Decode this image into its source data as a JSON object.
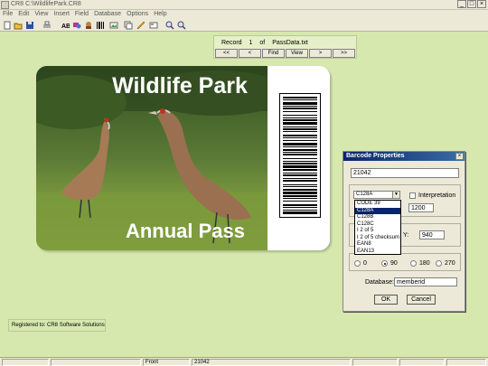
{
  "window": {
    "title": "CR8 C:\\WildlifePark.CR8"
  },
  "menu": [
    "File",
    "Edit",
    "View",
    "Insert",
    "Field",
    "Database",
    "Options",
    "Help"
  ],
  "record": {
    "label": "Record",
    "current": "1",
    "of": "of",
    "file": "PassData.txt"
  },
  "nav": [
    "<<",
    "<",
    "Find",
    "View",
    ">",
    ">>"
  ],
  "card": {
    "title": "Wildlife Park",
    "subtitle": "Annual Pass"
  },
  "dialog": {
    "title": "Barcode Properties",
    "value": "21042",
    "type_selected": "C128A",
    "interpretation_label": "Interpretation",
    "width_value": "1200",
    "y_label": "Y:",
    "y_value": "940",
    "rotation_options": [
      "0",
      "90",
      "180",
      "270"
    ],
    "rotation_selected": "90",
    "database_label": "Database:",
    "database_value": "memberid",
    "ok": "OK",
    "cancel": "Cancel",
    "type_options": [
      "CODE 39",
      "C128A",
      "C128B",
      "C128C",
      "I 2 of 5",
      "I 2 of 5 checksum",
      "EAN8",
      "EAN13"
    ]
  },
  "registered": "Registered to: CR8 Software Solutions",
  "status": {
    "side": "Front",
    "value": "21042"
  },
  "colors": {
    "background": "#d6e8ae",
    "dialog_title": "#0a246a",
    "selection": "#0a246a"
  }
}
